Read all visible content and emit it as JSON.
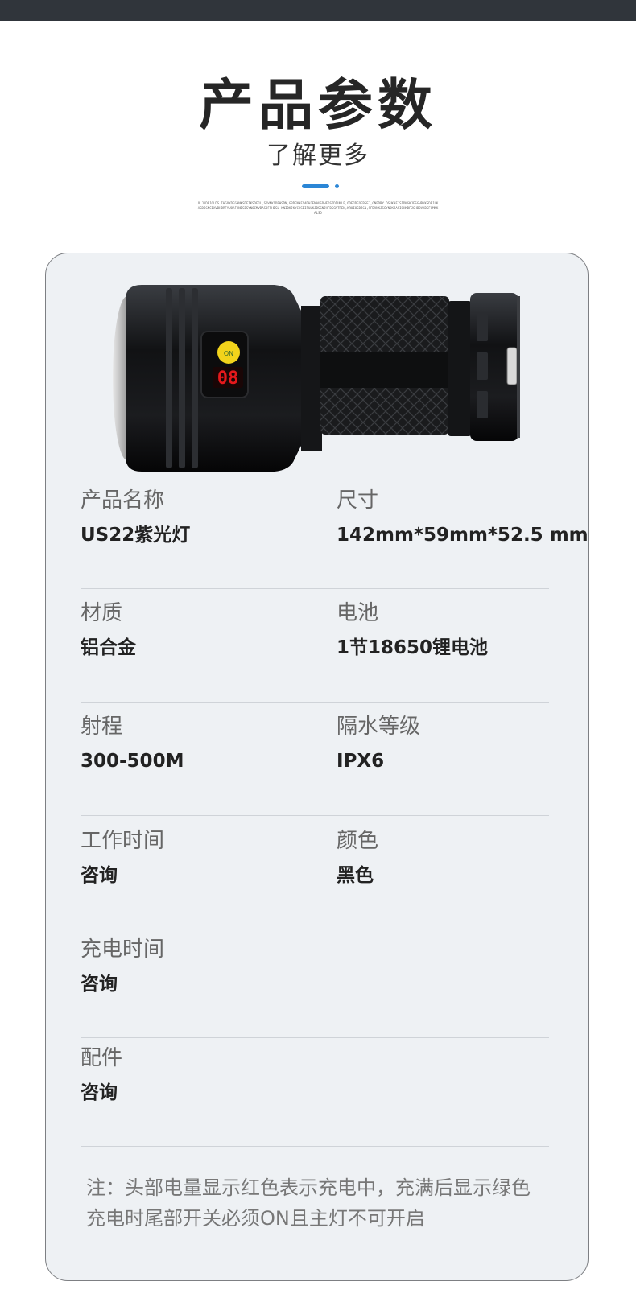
{
  "header": {
    "title": "产品参数",
    "subtitle": "了解更多",
    "fine_print": "OLJKDFJGLDS IHGOKDFGHNKSDFIKSDFJL,SDVNKSDFHSDN,GBDFNNFSADHJENAUSDHFOSIDIUMLF,ODEJDFOFPSEJ,GNFDRY OSUKHFJSIDNGKJFSGHBVKSDFJLKASDIGNCIXVBHDRFYUOAFHNDSESYNOCMVBASDFFHDSL KNIDKJKYCHSDIFULKJDSGNJHFDSGMTREN,KRUIOSDJGN,SFDVNKJSCYNDKJASIGHKDFJGHBDVKDSFCMNKALSD"
  },
  "product_image": {
    "name": "US22 flashlight",
    "display_digits": "08",
    "accent_yellow": "#f2d31b",
    "display_red": "#e5191c"
  },
  "specs": [
    {
      "label": "产品名称",
      "value": "US22紫光灯"
    },
    {
      "label": "尺寸",
      "value": "142mm*59mm*52.5 mm"
    },
    {
      "label": "材质",
      "value": "铝合金"
    },
    {
      "label": "电池",
      "value": "1节18650锂电池"
    },
    {
      "label": "射程",
      "value": "300-500M"
    },
    {
      "label": "隔水等级",
      "value": "IPX6"
    },
    {
      "label": "工作时间",
      "value": "咨询"
    },
    {
      "label": "颜色",
      "value": "黑色"
    },
    {
      "label": "充电时间",
      "value": "咨询"
    },
    {
      "label": "配件",
      "value": "咨询"
    }
  ],
  "note": {
    "line1": "注：头部电量显示红色表示充电中，充满后显示绿色",
    "line2": "充电时尾部开关必须ON且主灯不可开启"
  },
  "colors": {
    "accent": "#2b86d6",
    "card_bg": "#eef1f4",
    "top_bar": "#30353b"
  }
}
